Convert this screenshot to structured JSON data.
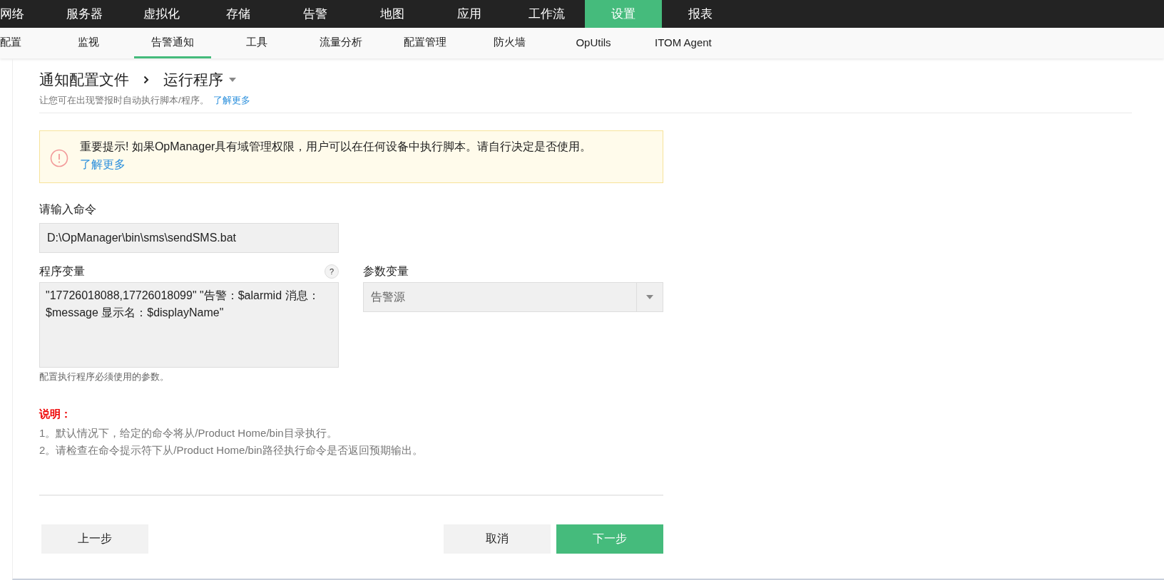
{
  "main_nav": [
    {
      "label": "网络",
      "selected": false
    },
    {
      "label": "服务器",
      "selected": false
    },
    {
      "label": "虚拟化",
      "selected": false
    },
    {
      "label": "存储",
      "selected": false
    },
    {
      "label": "告警",
      "selected": false
    },
    {
      "label": "地图",
      "selected": false
    },
    {
      "label": "应用",
      "selected": false
    },
    {
      "label": "工作流",
      "selected": false
    },
    {
      "label": "设置",
      "selected": true
    },
    {
      "label": "报表",
      "selected": false
    }
  ],
  "sub_nav": [
    {
      "label": "配置",
      "selected": false
    },
    {
      "label": "监视",
      "selected": false
    },
    {
      "label": "告警通知",
      "selected": true
    },
    {
      "label": "工具",
      "selected": false
    },
    {
      "label": "流量分析",
      "selected": false
    },
    {
      "label": "配置管理",
      "selected": false
    },
    {
      "label": "防火墙",
      "selected": false
    },
    {
      "label": "OpUtils",
      "selected": false
    },
    {
      "label": "ITOM Agent",
      "selected": false
    }
  ],
  "header": {
    "breadcrumb": "通知配置文件",
    "title": "运行程序",
    "description": "让您可在出现警报时自动执行脚本/程序。",
    "learn_more": "了解更多"
  },
  "warning": {
    "text": "重要提示! 如果OpManager具有域管理权限，用户可以在任何设备中执行脚本。请自行决定是否使用。",
    "learn_more": "了解更多"
  },
  "command": {
    "label": "请输入命令",
    "value": "D:\\OpManager\\bin\\sms\\sendSMS.bat"
  },
  "program_variables": {
    "label": "程序变量",
    "help": "?",
    "value": "\"17726018088,17726018099\" \"告警：$alarmid 消息：$message 显示名：$displayName\"",
    "hint": "配置执行程序必须使用的参数。"
  },
  "parameter_variables": {
    "label": "参数变量",
    "value": "告警源"
  },
  "notes": {
    "title": "说明：",
    "items": [
      "1。默认情况下，给定的命令将从/Product Home/bin目录执行。",
      "2。请检查在命令提示符下从/Product Home/bin路径执行命令是否返回预期输出。"
    ]
  },
  "buttons": {
    "back": "上一步",
    "cancel": "取消",
    "next": "下一步"
  }
}
